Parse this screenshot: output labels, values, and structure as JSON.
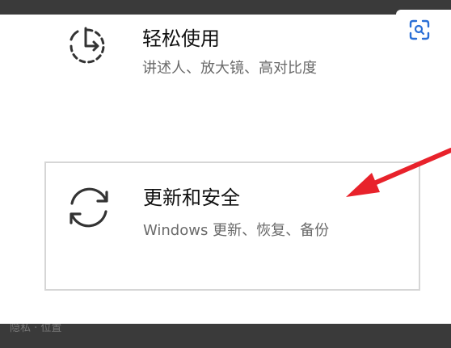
{
  "tiles": {
    "ease": {
      "title": "轻松使用",
      "subtitle": "讲述人、放大镜、高对比度",
      "icon": "ease-of-access-icon"
    },
    "update": {
      "title": "更新和安全",
      "subtitle": "Windows 更新、恢复、备份",
      "icon": "update-sync-icon"
    }
  },
  "overlay": {
    "scan_icon": "scan-search-icon",
    "arrow_color": "#e8222b"
  },
  "bottom_bar_text": "隐私  · 位置"
}
